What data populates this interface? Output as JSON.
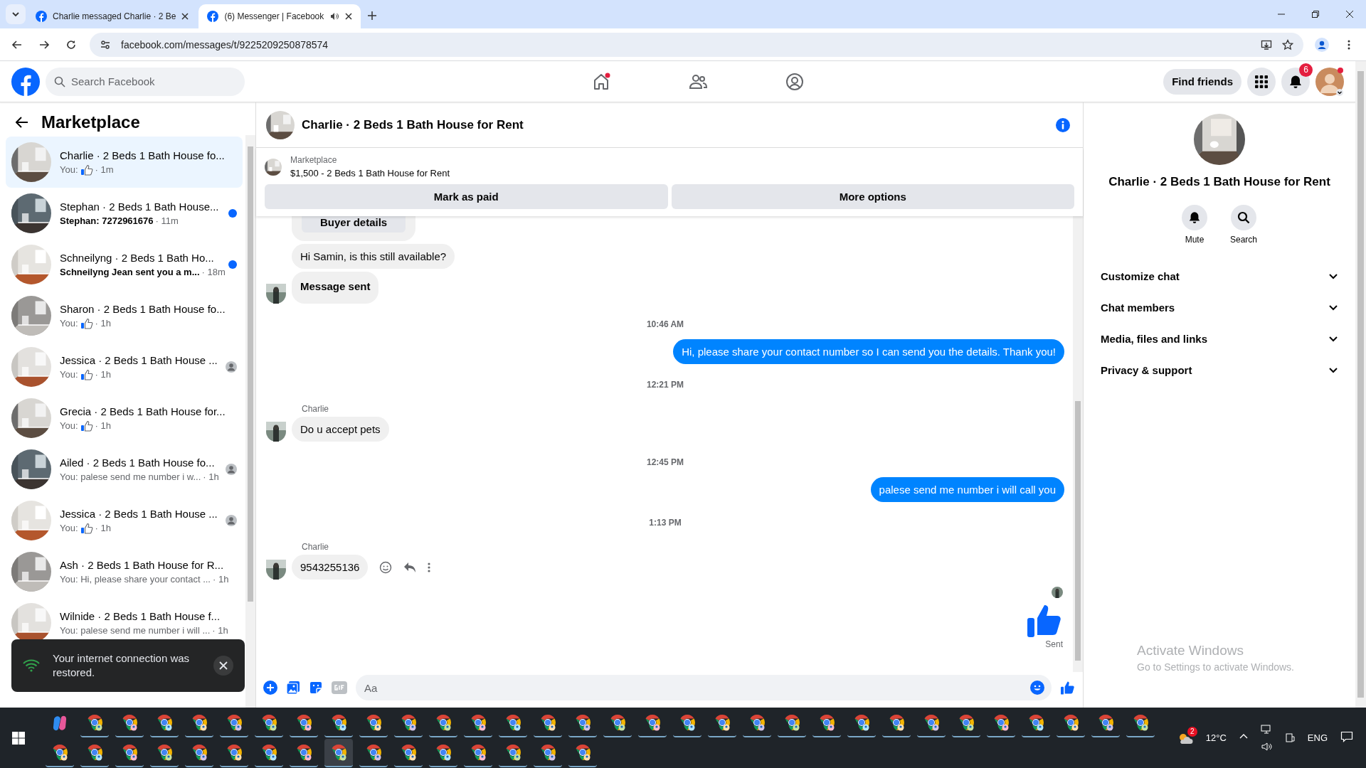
{
  "browser": {
    "tabs": [
      {
        "title": "Charlie messaged Charlie · 2 Be",
        "selected": false
      },
      {
        "title": "(6) Messenger | Facebook",
        "selected": true
      }
    ],
    "url": "facebook.com/messages/t/9225209250878574"
  },
  "header": {
    "search_placeholder": "Search Facebook",
    "find_friends": "Find friends",
    "notification_count": "6"
  },
  "sidebar": {
    "title": "Marketplace",
    "conversations": [
      {
        "title": "Charlie · 2 Beds 1 Bath House fo...",
        "preview": "You:",
        "like": true,
        "time": "· 1m",
        "selected": true,
        "unread": false,
        "seen": false
      },
      {
        "title": "Stephan · 2 Beds 1 Bath House...",
        "preview": "Stephan: 7272961676",
        "like": false,
        "time": "· 11m",
        "selected": false,
        "unread": true,
        "seen": false
      },
      {
        "title": "Schneilyng · 2 Beds 1 Bath Ho...",
        "preview": "Schneilyng Jean sent you a m...",
        "like": false,
        "time": "· 18m",
        "selected": false,
        "unread": true,
        "seen": false
      },
      {
        "title": "Sharon · 2 Beds 1 Bath House fo...",
        "preview": "You:",
        "like": true,
        "time": "· 1h",
        "selected": false,
        "unread": false,
        "seen": false
      },
      {
        "title": "Jessica · 2 Beds 1 Bath House ...",
        "preview": "You:",
        "like": true,
        "time": "· 1h",
        "selected": false,
        "unread": false,
        "seen": true
      },
      {
        "title": "Grecia · 2 Beds 1 Bath House for...",
        "preview": "You:",
        "like": true,
        "time": "· 1h",
        "selected": false,
        "unread": false,
        "seen": false
      },
      {
        "title": "Ailed · 2 Beds 1 Bath House fo...",
        "preview": "You: palese send me number i w...",
        "like": false,
        "time": "· 1h",
        "selected": false,
        "unread": false,
        "seen": true
      },
      {
        "title": "Jessica · 2 Beds 1 Bath House ...",
        "preview": "You:",
        "like": true,
        "time": "· 1h",
        "selected": false,
        "unread": false,
        "seen": true
      },
      {
        "title": "Ash · 2 Beds 1 Bath House for R...",
        "preview": "You: Hi, please share your contact ...",
        "like": false,
        "time": "· 1h",
        "selected": false,
        "unread": false,
        "seen": false
      },
      {
        "title": "Wilnide · 2 Beds 1 Bath House f...",
        "preview": "You: palese send me number i will ...",
        "like": false,
        "time": "· 1h",
        "selected": false,
        "unread": false,
        "seen": false
      }
    ]
  },
  "toast": {
    "text": "Your internet connection was restored."
  },
  "chat": {
    "title": "Charlie · 2 Beds 1 Bath House for Rent",
    "listing": {
      "label": "Marketplace",
      "title": "$1,500 - 2 Beds 1 Bath House for Rent"
    },
    "actions": [
      "Mark as paid",
      "More options"
    ],
    "messages": [
      {
        "kind": "card",
        "text": "Buyer details"
      },
      {
        "kind": "incoming",
        "text": "Hi Samin, is this still available?",
        "bold": false,
        "avatar": false
      },
      {
        "kind": "incoming",
        "text": "Message sent",
        "bold": true,
        "avatar": true
      },
      {
        "kind": "time",
        "text": "10:46 AM"
      },
      {
        "kind": "outgoing",
        "text": "Hi, please share your contact number so I can send you the details. Thank you!"
      },
      {
        "kind": "time",
        "text": "12:21 PM"
      },
      {
        "kind": "incoming",
        "sender": "Charlie",
        "text": "Do u accept pets",
        "bold": false,
        "avatar": true
      },
      {
        "kind": "time",
        "text": "12:45 PM"
      },
      {
        "kind": "outgoing",
        "text": "palese send me number i will call you"
      },
      {
        "kind": "time",
        "text": "1:13 PM"
      },
      {
        "kind": "incoming",
        "sender": "Charlie",
        "text": "9543255136",
        "bold": false,
        "avatar": true,
        "actions": true
      },
      {
        "kind": "like",
        "text": "Sent"
      }
    ],
    "composer": {
      "placeholder": "Aa"
    }
  },
  "details": {
    "name": "Charlie · 2 Beds 1 Bath House for Rent",
    "buttons": [
      {
        "label": "Mute",
        "kind": "mute"
      },
      {
        "label": "Search",
        "kind": "search"
      }
    ],
    "sections": [
      {
        "label": "Customize chat",
        "expanded": false
      },
      {
        "label": "Chat members",
        "expanded": false
      },
      {
        "label": "Media, files and links",
        "expanded": false
      },
      {
        "label": "Privacy & support",
        "expanded": false
      }
    ]
  },
  "os_notice": {
    "title": "Activate Windows",
    "text": "Go to Settings to activate Windows."
  },
  "taskbar": {
    "weather_badge": "2",
    "temperature": "12°C",
    "language": "ENG"
  }
}
